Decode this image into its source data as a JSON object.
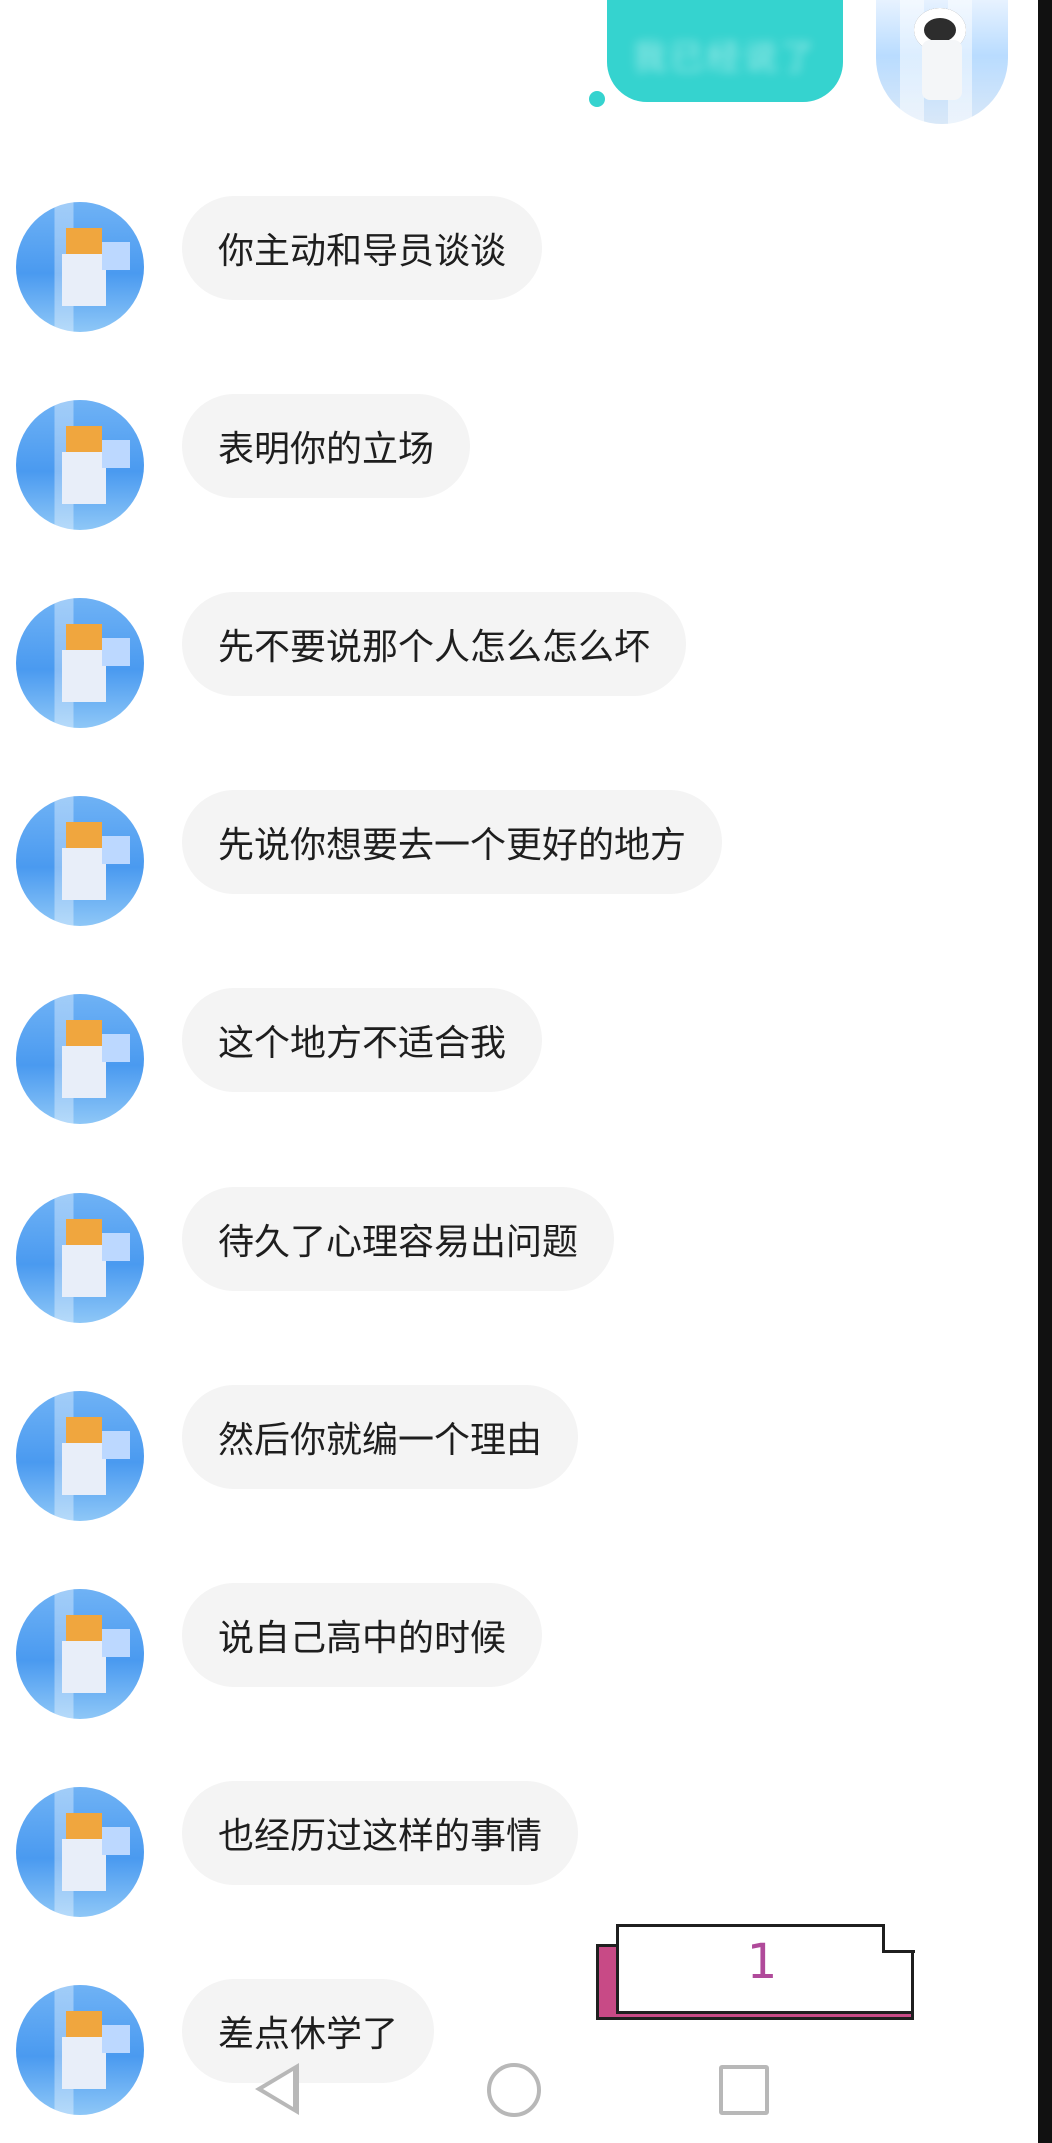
{
  "chat": {
    "sent_message": "我已经说了",
    "messages": [
      "你主动和导员谈谈",
      "表明你的立场",
      "先不要说那个人怎么怎么坏",
      "先说你想要去一个更好的地方",
      "这个地方不适合我",
      "待久了心理容易出问题",
      "然后你就编一个理由",
      "说自己高中的时候",
      "也经历过这样的事情",
      "差点休学了"
    ]
  },
  "page_tag": {
    "number": "1"
  },
  "colors": {
    "sent_bubble": "#35d3cf",
    "received_bubble": "#f4f4f4",
    "page_tag_accent": "#c84a86"
  },
  "icons": {
    "back": "back-triangle-icon",
    "home": "home-circle-icon",
    "recent": "recent-square-icon"
  }
}
